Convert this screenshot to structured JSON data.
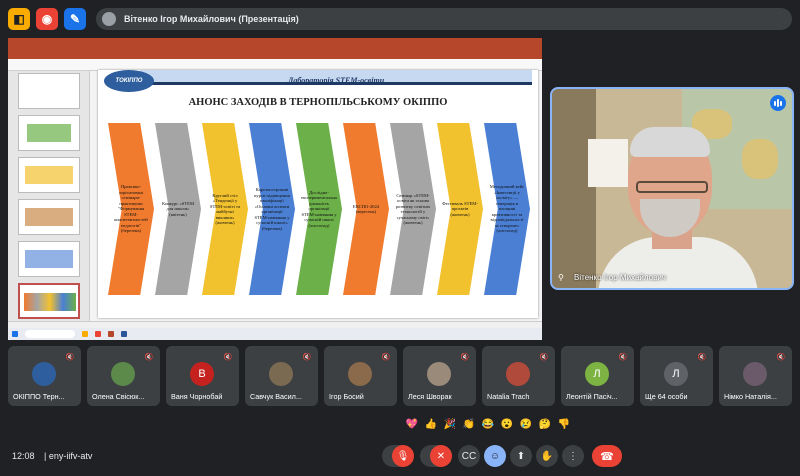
{
  "topbar": {
    "presenter_title": "Вітенко Ігор Михайлович (Презентація)",
    "icons": [
      {
        "name": "screen-share-icon",
        "glyph": "◧",
        "bg": "#f9ab00"
      },
      {
        "name": "record-icon",
        "glyph": "◉",
        "bg": "#ea4335"
      },
      {
        "name": "edit-icon",
        "glyph": "✎",
        "bg": "#1a73e8"
      }
    ]
  },
  "slide": {
    "lab_title": "Лабораторія STEM-освіти",
    "logo_text": "ТОКІППО",
    "heading": "АНОНС ЗАХОДІВ В ТЕРНОПІЛЬСЬКОМУ ОКІППО",
    "chevrons": [
      {
        "text": "Практико-зорієнтовані семінари-практикуми \"Формування STEM-компетентностей педагогів\" (березень)",
        "color": "#f07b2e"
      },
      {
        "text": "Конкурс «STEM для школи» (квітень)",
        "color": "#a5a5a5"
      },
      {
        "text": "Круглий стіл «Тенденції у STEM-освіті та майбутні виклики» (жовтень)",
        "color": "#f2c12e"
      },
      {
        "text": "Короткострокові курси підвищення кваліфікації «Основні аспекти організації STEM-навчання у сучасній школі» (березень)",
        "color": "#4a7fd4"
      },
      {
        "text": "Дослідно-експериментальна діяльність організації STEM-навчання у сучасній школі (листопад)",
        "color": "#6bb048"
      },
      {
        "text": "ЕКСПО-2024 (вересень)",
        "color": "#f07b2e"
      },
      {
        "text": "Семінар «STEM-освіта як основа розвитку освітніх технологій у сучасному світі» (жовтень)",
        "color": "#a5a5a5"
      },
      {
        "text": "Фестиваль STEM-проєктів (жовтень)",
        "color": "#f2c12e"
      },
      {
        "text": "Методичний кейс «Інвестиції у «освіту» — генерація в площині креативності та відповідальності за створене» (листопад)",
        "color": "#4a7fd4"
      }
    ]
  },
  "speaker": {
    "name": "Вітенко Ігор Михайлович"
  },
  "participants": [
    {
      "name": "ОКІППО Терн...",
      "avatar": "",
      "avatar_color": "#2e5e9e"
    },
    {
      "name": "Олена Свісюк...",
      "avatar": "",
      "avatar_color": "#5b8a4a"
    },
    {
      "name": "Ваня Чорнобай",
      "avatar": "В",
      "avatar_color": "#c5221f"
    },
    {
      "name": "Савчук Васил...",
      "avatar": "",
      "avatar_color": "#7a6a52"
    },
    {
      "name": "Ігор Босий",
      "avatar": "",
      "avatar_color": "#8a6a4a"
    },
    {
      "name": "Леся Шворак",
      "avatar": "",
      "avatar_color": "#9a8a7a"
    },
    {
      "name": "Natalia Trach",
      "avatar": "",
      "avatar_color": "#b04a3a"
    },
    {
      "name": "Леонтій Пасіч...",
      "avatar": "Л",
      "avatar_color": "#7cb342"
    },
    {
      "name": "Ще 64 особи",
      "avatar": "Л",
      "avatar_color": "#5f6368"
    },
    {
      "name": "Німко Наталія...",
      "avatar": "",
      "avatar_color": "#6a5a6a"
    }
  ],
  "reactions": [
    "💖",
    "👍",
    "🎉",
    "👏",
    "😂",
    "😮",
    "😢",
    "🤔",
    "👎"
  ],
  "bottombar": {
    "time": "12:08",
    "separator": "|",
    "meeting_code": "eny-iifv-atv"
  }
}
